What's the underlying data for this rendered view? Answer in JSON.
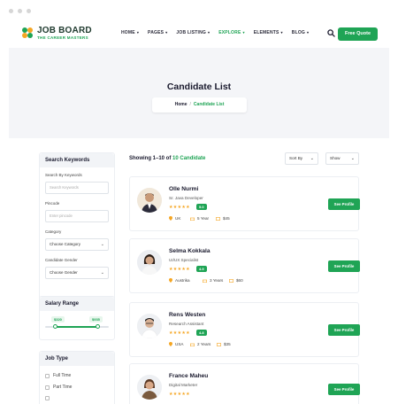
{
  "brand": {
    "name": "JOB BOARD",
    "tagline": "THE CAREER MASTERS",
    "accent": "#1fa455"
  },
  "nav": [
    {
      "label": "HOME",
      "active": false
    },
    {
      "label": "PAGES",
      "active": false
    },
    {
      "label": "JOB LISTING",
      "active": false
    },
    {
      "label": "EXPLORE",
      "active": true
    },
    {
      "label": "ELEMENTS",
      "active": false
    },
    {
      "label": "BLOG",
      "active": false
    }
  ],
  "header": {
    "search_icon": "search-icon",
    "cta_label": "Free Quote"
  },
  "hero": {
    "title": "Candidate List",
    "crumb_home": "Home",
    "crumb_sep": "/",
    "crumb_current": "Candidate List"
  },
  "sidebar": {
    "search": {
      "title": "Search Keywords",
      "keyword_label": "Search By Keywords",
      "keyword_placeholder": "Search Keywords",
      "pincode_label": "Pincode",
      "pincode_placeholder": "Enter pincode",
      "category_label": "Category",
      "category_value": "Choose Category",
      "gender_label": "Candidate Gender",
      "gender_value": "Choose Gender"
    },
    "salary": {
      "title": "Salary Range",
      "min": "$320",
      "max": "$935",
      "min_fraction": 0.16,
      "max_fraction": 0.82
    },
    "job_type": {
      "title": "Job Type",
      "options": [
        "Full Time",
        "Part Time"
      ]
    }
  },
  "list": {
    "showing_prefix": "Showing 1–10 of ",
    "showing_count": "10 Candidate",
    "sort_label": "Sort By",
    "show_label": "Show",
    "profile_label": "See Profile",
    "candidates": [
      {
        "name": "Olle Nurmi",
        "role": "Sr. Java Developer",
        "stars": "★★★★★",
        "rating": "5.0",
        "location": "UK",
        "experience": "5 Year",
        "rate": "$45"
      },
      {
        "name": "Selma Kokkala",
        "role": "UI/UX Specialist",
        "stars": "★★★★★",
        "rating": "4.9",
        "location": "Austrika",
        "experience": "3 Years",
        "rate": "$60"
      },
      {
        "name": "Rens Westen",
        "role": "Research Assistant",
        "stars": "★★★★★",
        "rating": "4.8",
        "location": "USA",
        "experience": "2 Years",
        "rate": "$35"
      },
      {
        "name": "France Maheu",
        "role": "Digital Marketer",
        "stars": "★★★★★",
        "rating": "",
        "location": "",
        "experience": "",
        "rate": ""
      }
    ]
  }
}
